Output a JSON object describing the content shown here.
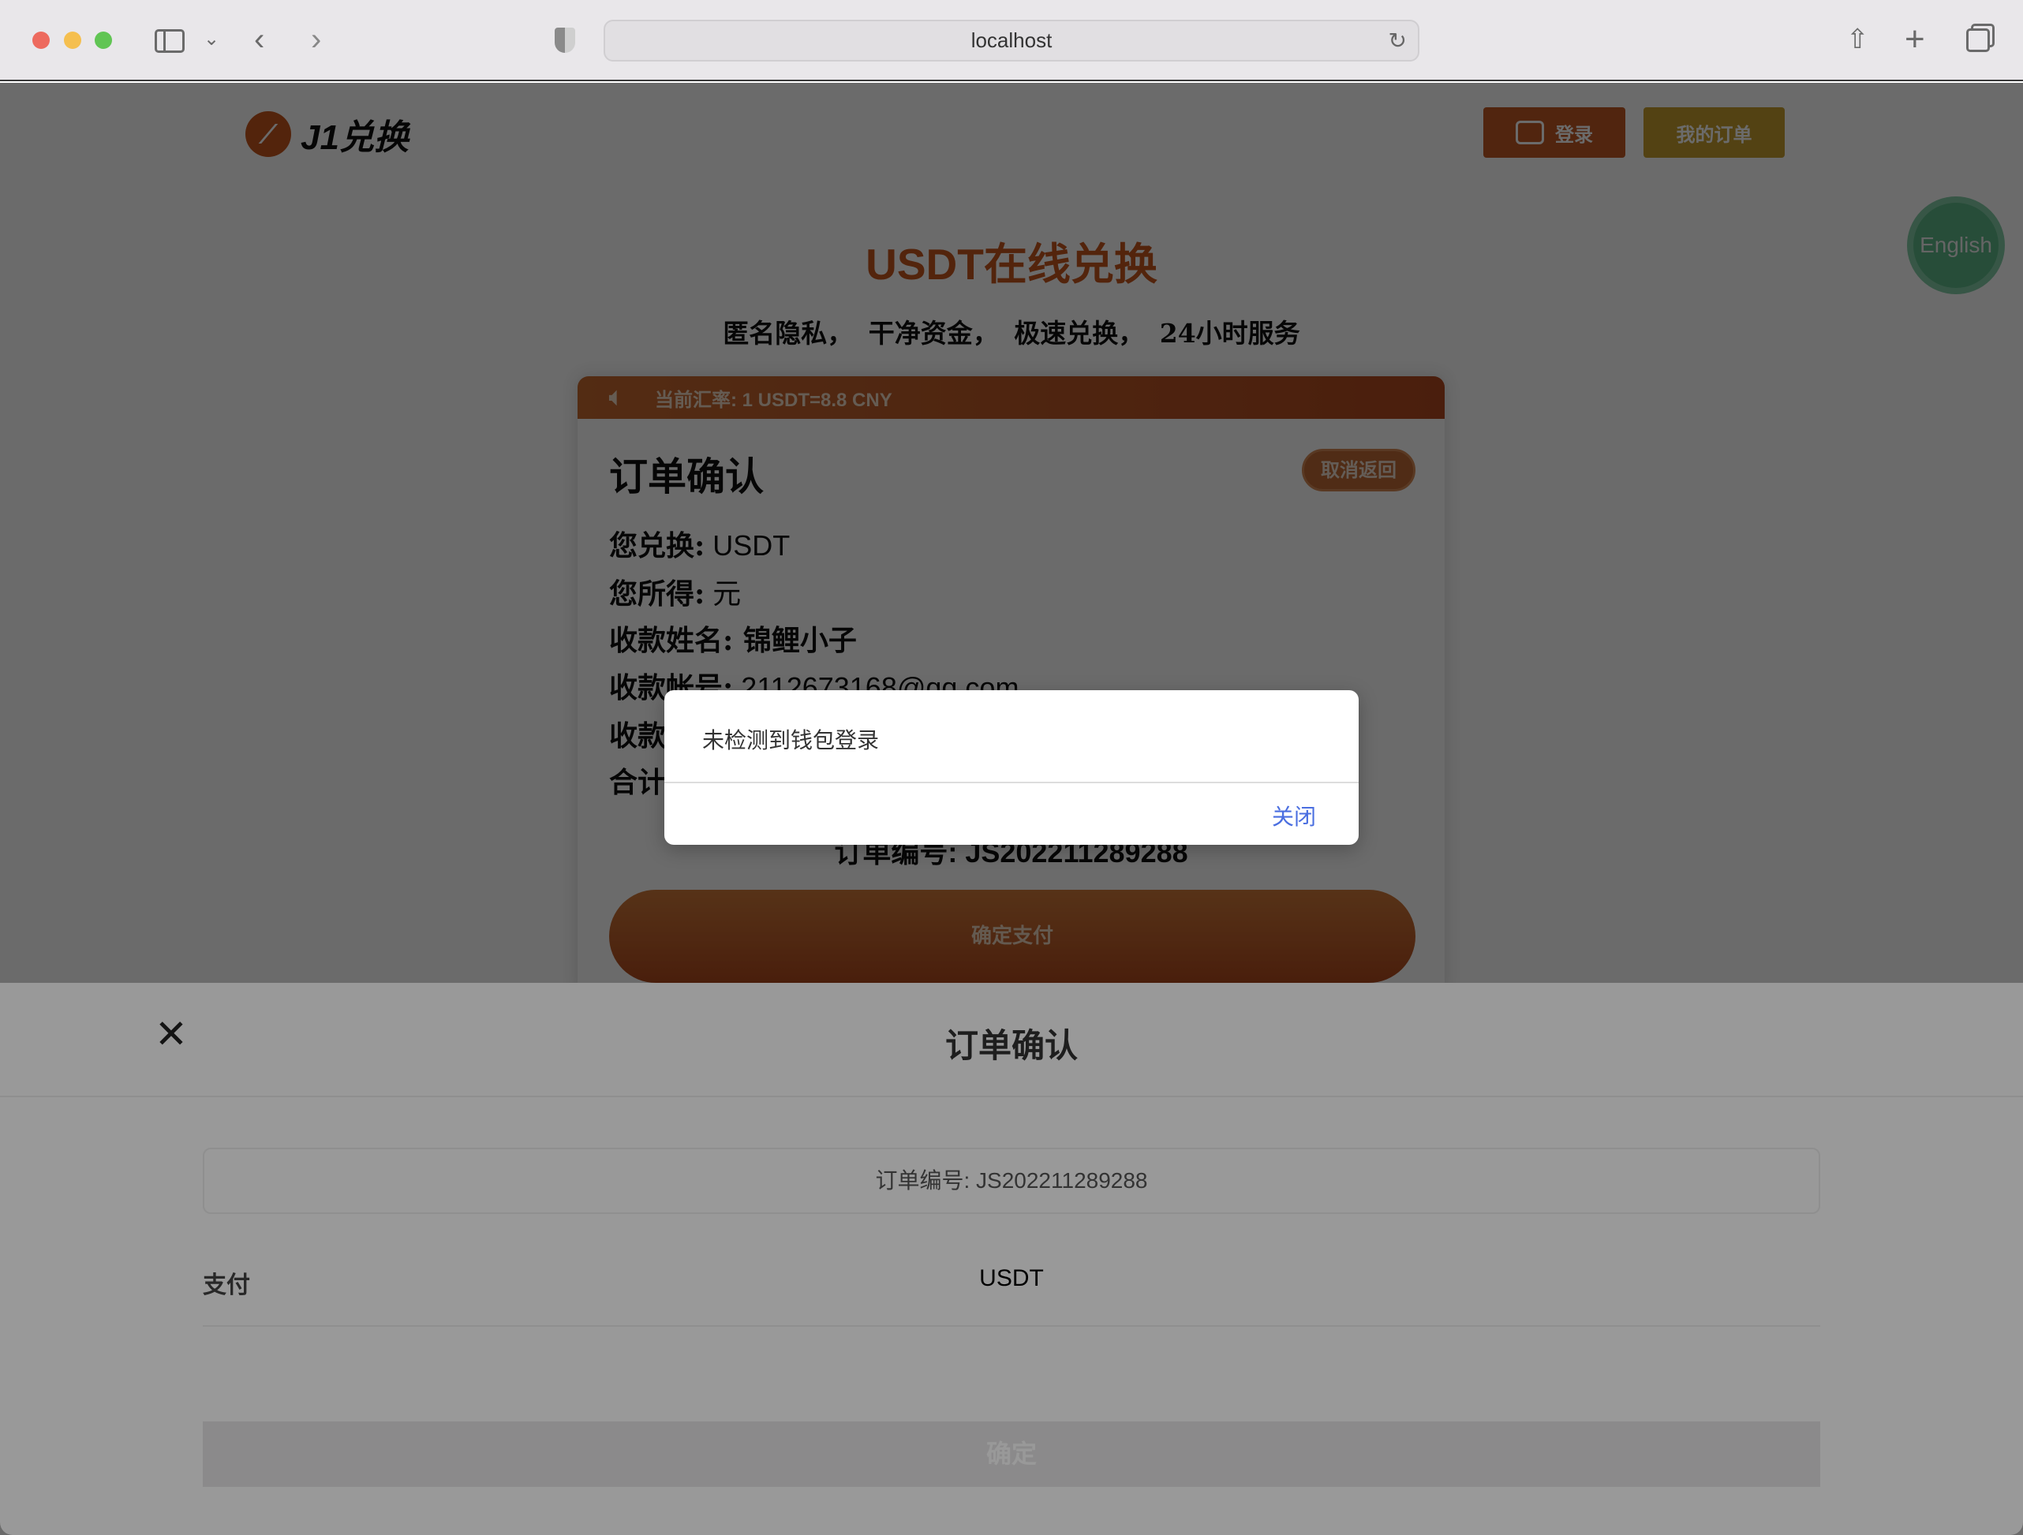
{
  "browser": {
    "url": "localhost"
  },
  "header": {
    "logo_text": "J1兑换",
    "login_label": "登录",
    "orders_label": "我的订单",
    "language_label": "English",
    "login_color": "#c25a26",
    "orders_color": "#c8a030"
  },
  "hero": {
    "title": "USDT在线兑换",
    "subtitle": "匿名隐私， 干净资金， 极速兑换， 24小时服务"
  },
  "card": {
    "rate": "当前汇率: 1 USDT=8.8 CNY",
    "title": "订单确认",
    "cancel_label": "取消返回",
    "lines": [
      {
        "label": "您兑换:",
        "value": " USDT"
      },
      {
        "label": "您所得:",
        "value": " 元"
      },
      {
        "label": "收款姓名:",
        "value": " 锦鲤小子"
      },
      {
        "label": "收款帐号:",
        "value": " 2112673168@qq.com"
      },
      {
        "label": "收款",
        "value": ""
      },
      {
        "label": "合计",
        "value": ""
      }
    ],
    "order_no": "订单编号: JS202211289288",
    "pay_label": "确定支付"
  },
  "sheet": {
    "title": "订单确认",
    "order_no": "订单编号:   JS202211289288",
    "pay_label": "支付",
    "pay_value": "USDT",
    "confirm_label": "确定"
  },
  "dialog": {
    "message": "未检测到钱包登录",
    "close_label": "关闭"
  }
}
